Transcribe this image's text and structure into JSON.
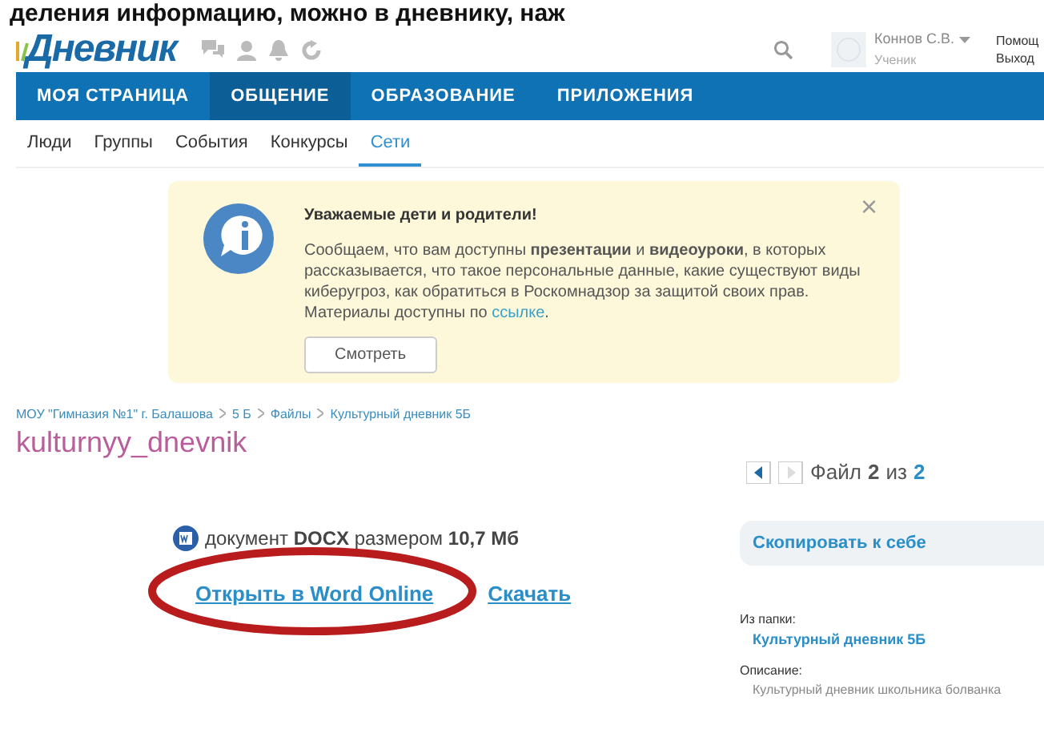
{
  "caption": "деления информацию, можно в дневнику, наж",
  "header": {
    "logo": "Дневник",
    "user": {
      "name": "Коннов С.В.",
      "role": "Ученик"
    },
    "links": [
      "Помощ",
      "Выход"
    ]
  },
  "nav": [
    {
      "label": "МОЯ СТРАНИЦА",
      "selected": false
    },
    {
      "label": "ОБЩЕНИЕ",
      "selected": true
    },
    {
      "label": "ОБРАЗОВАНИЕ",
      "selected": false
    },
    {
      "label": "ПРИЛОЖЕНИЯ",
      "selected": false
    }
  ],
  "subnav": [
    {
      "label": "Люди",
      "selected": false
    },
    {
      "label": "Группы",
      "selected": false
    },
    {
      "label": "События",
      "selected": false
    },
    {
      "label": "Конкурсы",
      "selected": false
    },
    {
      "label": "Сети",
      "selected": true
    }
  ],
  "notice": {
    "title": "Уважаемые дети и родители!",
    "text": "Сообщаем, что вам доступны **презентации** и **видеоуроки**, в которых рассказывается, что такое персональные данные, какие существуют виды киберугроз, как обратиться в Роскомнадзор за защитой своих прав. Материалы доступны по",
    "link": "ссылке",
    "after": ".",
    "button": "Смотреть",
    "close": "×"
  },
  "breadcrumbs": [
    "МОУ \"Гимназия №1\" г. Балашова",
    "5 Б",
    "Файлы",
    "Культурный дневник 5Б"
  ],
  "title": "kulturnyy_dnevnik",
  "file": {
    "info": "документ **DOCX** размером **10,7 Мб**",
    "open": "Открыть в Word Online",
    "download": "Скачать"
  },
  "pager": {
    "label": "Файл",
    "current": "2",
    "of": "из",
    "total": "2"
  },
  "sidebar": {
    "copy": "Скопировать к себе",
    "folder_label": "Из папки:",
    "folder": "Культурный дневник 5Б",
    "desc_label": "Описание:",
    "desc": "Культурный дневник школьника болванка"
  }
}
